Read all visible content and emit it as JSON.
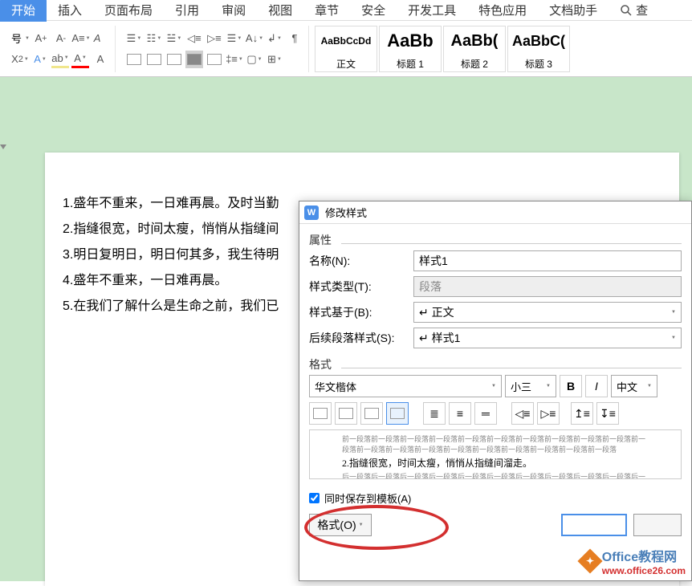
{
  "tabs": [
    "开始",
    "插入",
    "页面布局",
    "引用",
    "审阅",
    "视图",
    "章节",
    "安全",
    "开发工具",
    "特色应用",
    "文档助手",
    "查"
  ],
  "ribbon": {
    "left_label": "号"
  },
  "style_gallery": [
    {
      "preview": "AaBbCcDd",
      "label": "正文",
      "size": "12px"
    },
    {
      "preview": "AaBb",
      "label": "标题 1",
      "size": "22px"
    },
    {
      "preview": "AaBb(",
      "label": "标题 2",
      "size": "20px"
    },
    {
      "preview": "AaBbC(",
      "label": "标题 3",
      "size": "18px"
    }
  ],
  "document_lines": [
    "1.盛年不重来，一日难再晨。及时当勤",
    "2.指缝很宽，时间太瘦，悄悄从指缝间",
    "3.明日复明日，明日何其多，我生待明",
    "4.盛年不重来，一日难再晨。",
    "5.在我们了解什么是生命之前，我们已"
  ],
  "dialog": {
    "title": "修改样式",
    "section_attr": "属性",
    "labels": {
      "name": "名称(N):",
      "type": "样式类型(T):",
      "base": "样式基于(B):",
      "next": "后续段落样式(S):"
    },
    "values": {
      "name": "样式1",
      "type": "段落",
      "base": "↵ 正文",
      "next": "↵ 样式1"
    },
    "section_fmt": "格式",
    "font": "华文楷体",
    "size": "小三",
    "lang": "中文",
    "preview": {
      "para_before": "前一段落前一段落前一段落前一段落前一段落前一段落前一段落前一段落前一段落前一段落前一段落前一段落前一段落前一段落前一段落前一段落前一段落前一段落前一段落前一段落",
      "main": "2.指缝很宽，时间太瘦，悄悄从指缝间溜走。",
      "para_after": "后一段落后一段落后一段落后一段落后一段落后一段落后一段落后一段落后一段落后一段落后一段落"
    },
    "checkbox": "同时保存到模板(A)",
    "btn_format": "格式(O)"
  },
  "watermark": {
    "brand": "Office教程网",
    "url": "www.office26.com"
  }
}
